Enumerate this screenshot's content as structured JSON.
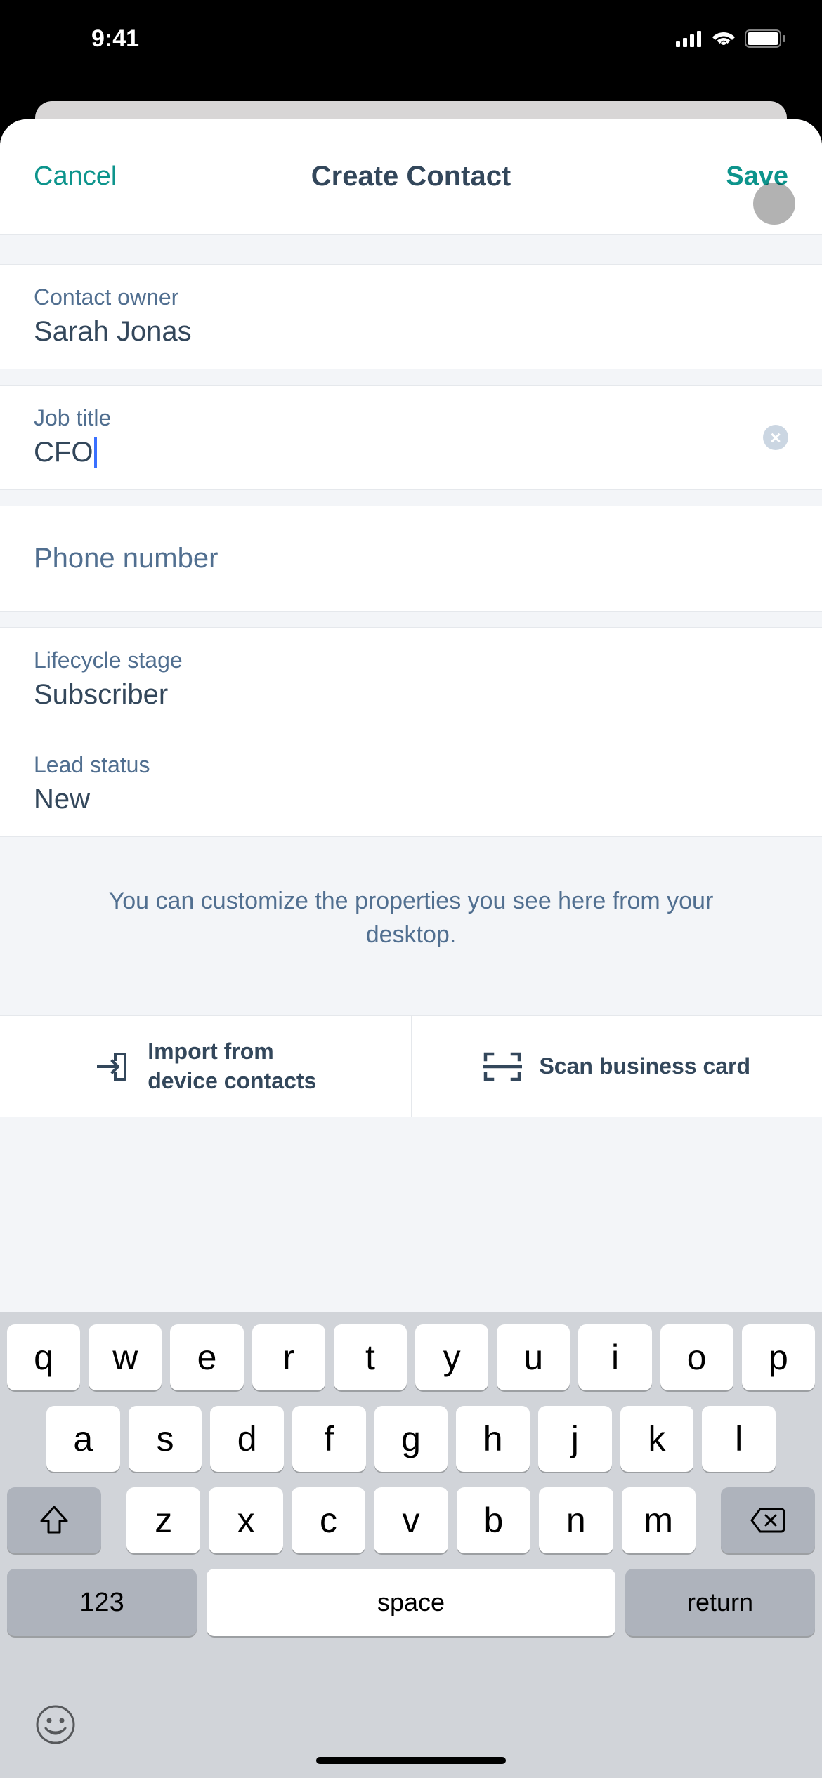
{
  "status": {
    "time": "9:41"
  },
  "nav": {
    "cancel": "Cancel",
    "title": "Create Contact",
    "save": "Save"
  },
  "fields": {
    "owner_label": "Contact owner",
    "owner_value": "Sarah Jonas",
    "job_label": "Job title",
    "job_value": "CFO",
    "phone_placeholder": "Phone number",
    "lifecycle_label": "Lifecycle stage",
    "lifecycle_value": "Subscriber",
    "lead_label": "Lead status",
    "lead_value": "New"
  },
  "tip": "You can customize the properties you see here from your desktop.",
  "actions": {
    "import_line1": "Import from",
    "import_line2": "device contacts",
    "scan": "Scan business card"
  },
  "keyboard": {
    "row1": [
      "q",
      "w",
      "e",
      "r",
      "t",
      "y",
      "u",
      "i",
      "o",
      "p"
    ],
    "row2": [
      "a",
      "s",
      "d",
      "f",
      "g",
      "h",
      "j",
      "k",
      "l"
    ],
    "row3": [
      "z",
      "x",
      "c",
      "v",
      "b",
      "n",
      "m"
    ],
    "num": "123",
    "space": "space",
    "return": "return"
  }
}
